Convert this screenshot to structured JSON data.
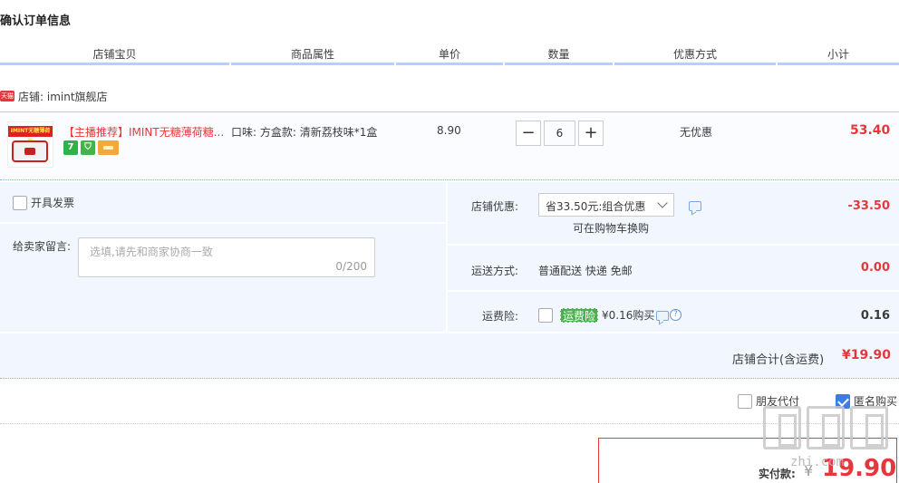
{
  "page": {
    "title": "确认订单信息"
  },
  "columns": [
    "店铺宝贝",
    "商品属性",
    "单价",
    "数量",
    "优惠方式",
    "小计"
  ],
  "shop": {
    "badge": "天猫",
    "name": "店铺: imint旗舰店"
  },
  "item": {
    "title": "【主播推荐】IMINT无糖薄荷糖...",
    "thumb_text": "IMINT无糖薄荷糖",
    "promo_icons": [
      "seven-day-return-icon",
      "shield-icon",
      "card-icon"
    ],
    "seven_label": "7",
    "attribute": "口味: 方盒款: 清新荔枝味*1盒",
    "price": "8.90",
    "quantity": "6",
    "minus": "−",
    "plus": "+",
    "discount": "无优惠",
    "subtotal": "53.40"
  },
  "invoice": {
    "label": "开具发票"
  },
  "message": {
    "label": "给卖家留言:",
    "placeholder": "选填,请先和商家协商一致",
    "counter": "0/200"
  },
  "shop_discount": {
    "label": "店铺优惠:",
    "selected": "省33.50元:组合优惠",
    "hint": "可在购物车换购",
    "value": "-33.50"
  },
  "shipping": {
    "label": "运送方式:",
    "method": "普通配送 快递 免邮",
    "value": "0.00"
  },
  "insurance": {
    "label": "运费险:",
    "tag": "运费险",
    "price": "¥0.16购买",
    "value": "0.16",
    "help": "?"
  },
  "shop_total": {
    "label": "店铺合计(含运费)",
    "value": "¥19.90"
  },
  "options": {
    "friend_pay": "朋友代付",
    "anonymous": "匿名购买"
  },
  "payment": {
    "label": "实付款:",
    "currency": "¥",
    "amount": "19.90"
  },
  "watermark": {
    "text": "zhi.com"
  },
  "colors": {
    "accent": "#e4393c",
    "header_line": "#b2d1ff",
    "panel_bg": "#f2f7ff"
  }
}
